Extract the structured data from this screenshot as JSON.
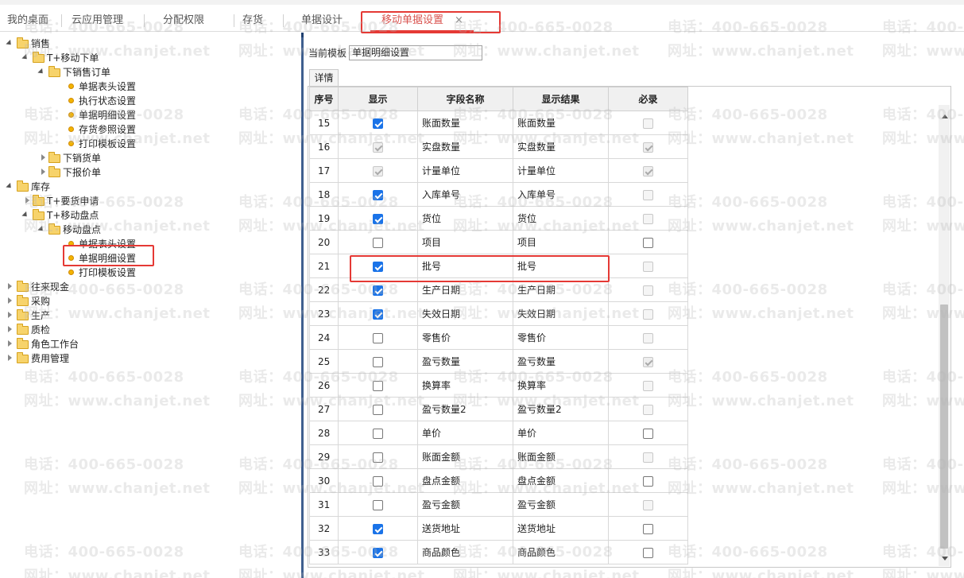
{
  "tabs": [
    {
      "label": "我的桌面"
    },
    {
      "label": "云应用管理"
    },
    {
      "label": "分配权限"
    },
    {
      "label": "存货"
    },
    {
      "label": "单据设计"
    },
    {
      "label": "移动单据设置",
      "close": "×"
    }
  ],
  "watermark": {
    "phone": "电话：400-665-0028",
    "site": "网址：www.chanjet.net"
  },
  "tree": {
    "sales": "销售",
    "t_mobile_order": "T+移动下单",
    "sales_order": "下销售订单",
    "header_setting_1": "单据表头设置",
    "exec_status": "执行状态设置",
    "detail_setting_1": "单据明细设置",
    "inv_ref": "存货参照设置",
    "print_tpl_1": "打印模板设置",
    "sales_delivery": "下销货单",
    "quote": "下报价单",
    "inventory": "库存",
    "t_requisition": "T+要货申请",
    "t_mobile_count": "T+移动盘点",
    "mobile_count": "移动盘点",
    "header_setting_2": "单据表头设置",
    "detail_setting_2": "单据明细设置",
    "print_tpl_2": "打印模板设置",
    "cash": "往来现金",
    "purchase": "采购",
    "production": "生产",
    "qc": "质检",
    "role_workbench": "角色工作台",
    "expense": "费用管理"
  },
  "panel": {
    "template_label": "当前模板",
    "template_value": "单据明细设置",
    "detail_tab": "详情"
  },
  "grid": {
    "headers": {
      "seq": "序号",
      "show": "显示",
      "field": "字段名称",
      "result": "显示结果",
      "required": "必录"
    },
    "rows": [
      {
        "seq": "15",
        "show": true,
        "show_disabled": false,
        "field": "账面数量",
        "result": "账面数量",
        "req": false,
        "req_disabled": true
      },
      {
        "seq": "16",
        "show": true,
        "show_disabled": true,
        "field": "实盘数量",
        "result": "实盘数量",
        "req": true,
        "req_disabled": true
      },
      {
        "seq": "17",
        "show": true,
        "show_disabled": true,
        "field": "计量单位",
        "result": "计量单位",
        "req": true,
        "req_disabled": true
      },
      {
        "seq": "18",
        "show": true,
        "show_disabled": false,
        "field": "入库单号",
        "result": "入库单号",
        "req": false,
        "req_disabled": true
      },
      {
        "seq": "19",
        "show": true,
        "show_disabled": false,
        "field": "货位",
        "result": "货位",
        "req": false,
        "req_disabled": true
      },
      {
        "seq": "20",
        "show": false,
        "show_disabled": false,
        "field": "项目",
        "result": "项目",
        "req": false,
        "req_disabled": false
      },
      {
        "seq": "21",
        "show": true,
        "show_disabled": false,
        "field": "批号",
        "result": "批号",
        "req": false,
        "req_disabled": true
      },
      {
        "seq": "22",
        "show": true,
        "show_disabled": false,
        "field": "生产日期",
        "result": "生产日期",
        "req": false,
        "req_disabled": true
      },
      {
        "seq": "23",
        "show": true,
        "show_disabled": false,
        "field": "失效日期",
        "result": "失效日期",
        "req": false,
        "req_disabled": true
      },
      {
        "seq": "24",
        "show": false,
        "show_disabled": false,
        "field": "零售价",
        "result": "零售价",
        "req": false,
        "req_disabled": true
      },
      {
        "seq": "25",
        "show": false,
        "show_disabled": false,
        "field": "盈亏数量",
        "result": "盈亏数量",
        "req": true,
        "req_disabled": true
      },
      {
        "seq": "26",
        "show": false,
        "show_disabled": false,
        "field": "换算率",
        "result": "换算率",
        "req": false,
        "req_disabled": true
      },
      {
        "seq": "27",
        "show": false,
        "show_disabled": false,
        "field": "盈亏数量2",
        "result": "盈亏数量2",
        "req": false,
        "req_disabled": true
      },
      {
        "seq": "28",
        "show": false,
        "show_disabled": false,
        "field": "单价",
        "result": "单价",
        "req": false,
        "req_disabled": false
      },
      {
        "seq": "29",
        "show": false,
        "show_disabled": false,
        "field": "账面金额",
        "result": "账面金额",
        "req": false,
        "req_disabled": true
      },
      {
        "seq": "30",
        "show": false,
        "show_disabled": false,
        "field": "盘点金额",
        "result": "盘点金额",
        "req": false,
        "req_disabled": false
      },
      {
        "seq": "31",
        "show": false,
        "show_disabled": false,
        "field": "盈亏金额",
        "result": "盈亏金额",
        "req": false,
        "req_disabled": true
      },
      {
        "seq": "32",
        "show": true,
        "show_disabled": false,
        "field": "送货地址",
        "result": "送货地址",
        "req": false,
        "req_disabled": false
      },
      {
        "seq": "33",
        "show": true,
        "show_disabled": false,
        "field": "商品颜色",
        "result": "商品颜色",
        "req": false,
        "req_disabled": false
      }
    ]
  },
  "colors": {
    "accent": "#e53935",
    "checkbox": "#1a73e8"
  }
}
